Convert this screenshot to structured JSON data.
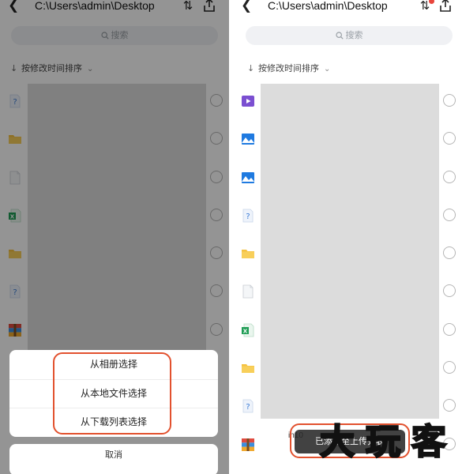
{
  "screens": {
    "left": {
      "path": "C:\\Users\\admin\\Desktop",
      "search_placeholder": "搜索",
      "sort_label": "按修改时间排序",
      "rows": [
        {
          "icon": "unknown-file-icon"
        },
        {
          "icon": "folder-icon"
        },
        {
          "icon": "blank-document-icon"
        },
        {
          "icon": "excel-file-icon"
        },
        {
          "icon": "folder-icon"
        },
        {
          "icon": "unknown-file-icon"
        },
        {
          "icon": "archive-file-icon"
        }
      ],
      "action_sheet": {
        "items": [
          "从相册选择",
          "从本地文件选择",
          "从下载列表选择"
        ],
        "cancel_label": "取消"
      }
    },
    "right": {
      "path": "C:\\Users\\admin\\Desktop",
      "search_placeholder": "搜索",
      "sort_label": "按修改时间排序",
      "peek_text": "in10",
      "rows": [
        {
          "icon": "video-file-icon"
        },
        {
          "icon": "image-file-icon"
        },
        {
          "icon": "image-file-icon"
        },
        {
          "icon": "unknown-file-icon"
        },
        {
          "icon": "folder-icon"
        },
        {
          "icon": "blank-document-icon"
        },
        {
          "icon": "excel-file-icon"
        },
        {
          "icon": "folder-icon"
        },
        {
          "icon": "unknown-file-icon"
        },
        {
          "icon": "archive-file-icon"
        }
      ],
      "toast": "已添加至上传列表"
    }
  },
  "watermark": "大玩客",
  "colors": {
    "highlight": "#e2512e",
    "badge": "#e8453c",
    "folder": "#f5c242",
    "image_icon": "#1f7ae0",
    "video_icon": "#7b4fd1",
    "excel_icon": "#1f9d55"
  }
}
